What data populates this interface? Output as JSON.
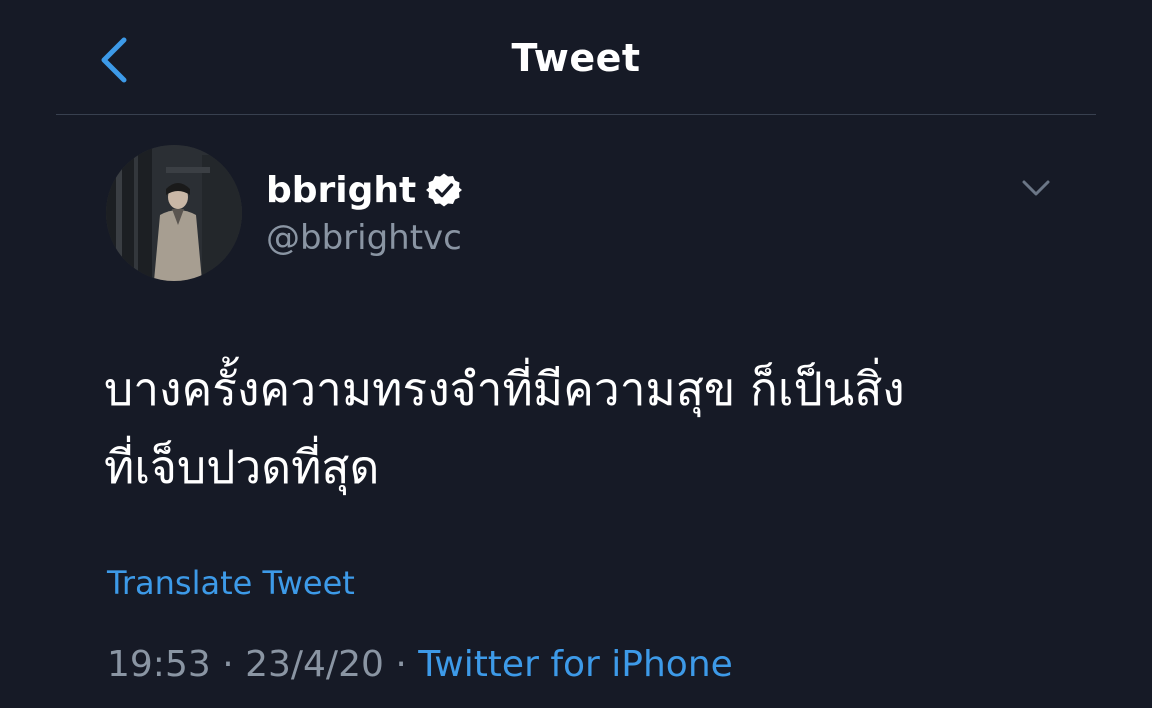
{
  "header": {
    "title": "Tweet",
    "back_icon": "chevron-left-icon"
  },
  "author": {
    "display_name": "bbright",
    "handle": "@bbrightvc",
    "verified": true
  },
  "tweet": {
    "text_line1": "บางครั้งความทรงจำที่มีความสุข ก็เป็นสิ่ง",
    "text_line2": "ที่เจ็บปวดที่สุด"
  },
  "translate_label": "Translate Tweet",
  "meta": {
    "time": "19:53",
    "separator1": " · ",
    "date": "23/4/20",
    "separator2": " · ",
    "source": "Twitter for iPhone"
  },
  "colors": {
    "background": "#161a26",
    "accent": "#3d9ae8",
    "muted": "#8a95a3"
  }
}
